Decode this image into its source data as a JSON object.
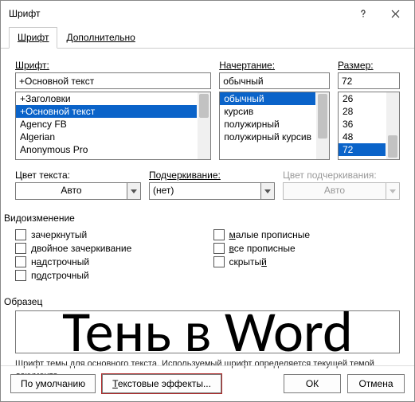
{
  "window": {
    "title": "Шрифт"
  },
  "tabs": {
    "font": "Шрифт",
    "advanced": "Дополнительно"
  },
  "labels": {
    "font": "Шрифт:",
    "style": "Начертание:",
    "size": "Размер:",
    "font_color": "Цвет текста:",
    "underline": "Подчеркивание:",
    "underline_color": "Цвет подчеркивания:",
    "effects": "Видоизменение",
    "sample": "Образец"
  },
  "font": {
    "value": "+Основной текст",
    "items": [
      "+Заголовки",
      "+Основной текст",
      "Agency FB",
      "Algerian",
      "Anonymous Pro"
    ],
    "selected_index": 1
  },
  "style": {
    "value": "обычный",
    "items": [
      "обычный",
      "курсив",
      "полужирный",
      "полужирный курсив"
    ],
    "selected_index": 0
  },
  "size": {
    "value": "72",
    "items": [
      "26",
      "28",
      "36",
      "48",
      "72"
    ],
    "selected_index": 4
  },
  "font_color": {
    "value": "Авто"
  },
  "underline": {
    "value": "(нет)"
  },
  "underline_color": {
    "value": "Авто"
  },
  "effects": {
    "strike": "зачеркнутый",
    "dstrike": "двойное зачеркивание",
    "super": "надстрочный",
    "sub": "подстрочный",
    "smallcaps": "малые прописные",
    "allcaps": "все прописные",
    "hidden": "скрытый"
  },
  "preview": {
    "text": "Тень в Word"
  },
  "description": "Шрифт темы для основного текста. Используемый шрифт определяется текущей темой документа.",
  "buttons": {
    "default": "По умолчанию",
    "text_effects": "Текстовые эффекты...",
    "ok": "ОК",
    "cancel": "Отмена"
  }
}
